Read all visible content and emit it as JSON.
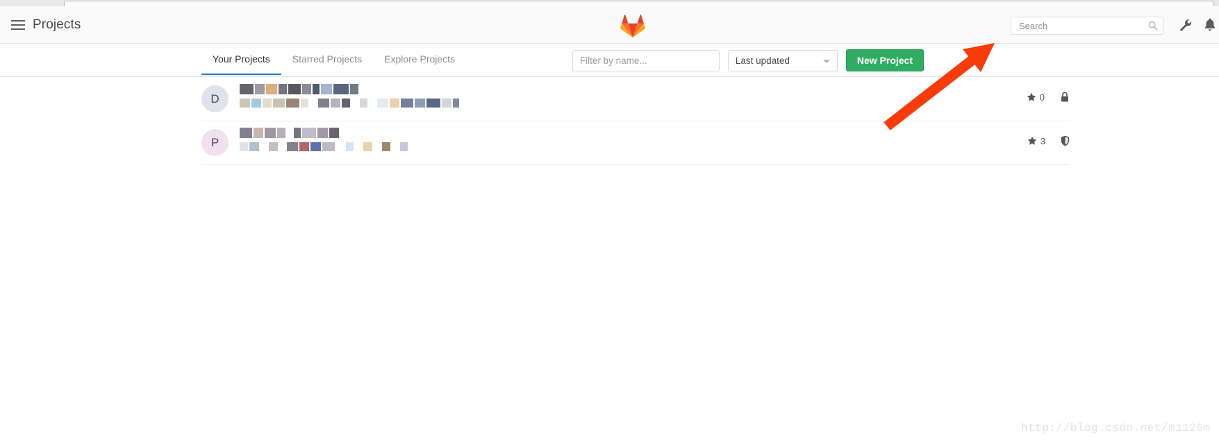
{
  "browser": {
    "urlbar_visible": true
  },
  "navbar": {
    "title": "Projects",
    "menu_icon": "hamburger-icon",
    "logo_icon": "gitlab-tanuki-logo",
    "search": {
      "placeholder": "Search",
      "value": "",
      "icon": "search-icon"
    },
    "wrench_icon": "wrench-icon",
    "bell_icon": "bell-icon"
  },
  "subnav": {
    "tabs": [
      {
        "label": "Your Projects",
        "active": true
      },
      {
        "label": "Starred Projects",
        "active": false
      },
      {
        "label": "Explore Projects",
        "active": false
      }
    ],
    "filter": {
      "placeholder": "Filter by name...",
      "value": ""
    },
    "sort": {
      "selected": "Last updated",
      "caret_icon": "chevron-down-icon"
    },
    "new_project_label": "New Project"
  },
  "projects": [
    {
      "avatar_letter": "D",
      "avatar_bg": "#dfe3ef",
      "name_redacted": true,
      "description_redacted": true,
      "stars": "0",
      "visibility_icon": "lock-icon"
    },
    {
      "avatar_letter": "P",
      "avatar_bg": "#f2dff0",
      "name_redacted": true,
      "description_redacted": true,
      "stars": "3",
      "visibility_icon": "shield-icon"
    }
  ],
  "annotation": {
    "arrow_color": "#f73c0a",
    "arrow_points_to": "New Project"
  },
  "watermark": {
    "text": "http://blog.csdn.net/m1126m"
  },
  "colors": {
    "accent_green": "#31ad63",
    "tab_underline": "#1f78d1",
    "arrow_red": "#f73c0a",
    "navbar_bg": "#fafafa"
  }
}
